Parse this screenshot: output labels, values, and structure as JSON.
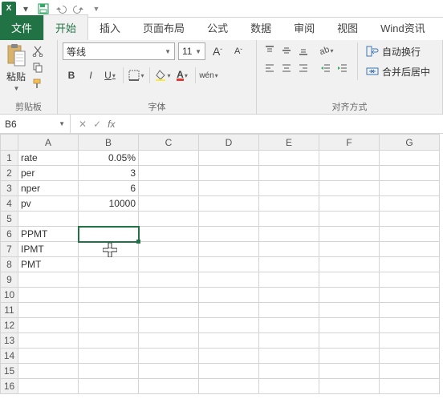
{
  "qat": {
    "app": "X"
  },
  "tabs": {
    "file": "文件",
    "home": "开始",
    "insert": "插入",
    "layout": "页面布局",
    "formulas": "公式",
    "data": "数据",
    "review": "审阅",
    "view": "视图",
    "wind": "Wind资讯"
  },
  "ribbon": {
    "clipboard": {
      "paste": "粘贴",
      "label": "剪贴板"
    },
    "font": {
      "name": "等线",
      "size": "11",
      "bold": "B",
      "italic": "I",
      "underline": "U",
      "wen": "wén",
      "bigA": "A",
      "smallA": "A",
      "label": "字体"
    },
    "align": {
      "wrap": "自动换行",
      "merge": "合并后居中",
      "label": "对齐方式"
    }
  },
  "namebox": {
    "ref": "B6",
    "fx": "fx"
  },
  "columns": [
    "A",
    "B",
    "C",
    "D",
    "E",
    "F",
    "G"
  ],
  "rows": [
    "1",
    "2",
    "3",
    "4",
    "5",
    "6",
    "7",
    "8",
    "9",
    "10",
    "11",
    "12",
    "13",
    "14",
    "15",
    "16"
  ],
  "cells": {
    "A1": "rate",
    "B1": "0.05%",
    "A2": "per",
    "B2": "3",
    "A3": "nper",
    "B3": "6",
    "A4": "pv",
    "B4": "10000",
    "A6": "PPMT",
    "A7": "IPMT",
    "A8": "PMT"
  },
  "active": "B6"
}
